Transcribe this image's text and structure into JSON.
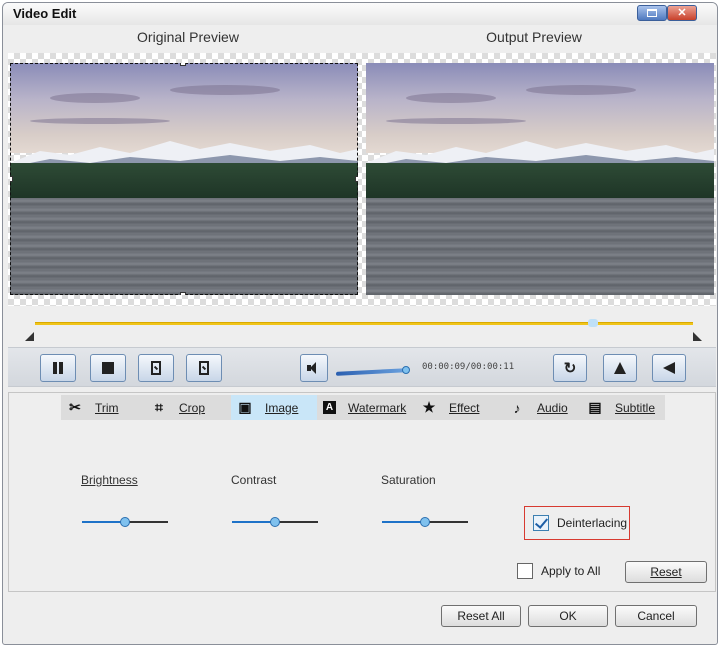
{
  "window": {
    "title": "Video Edit",
    "max_glyph": "max-icon",
    "close_glyph": "✕"
  },
  "preview": {
    "original_label": "Original Preview",
    "output_label": "Output Preview"
  },
  "playback": {
    "time": "00:00:09/00:00:11"
  },
  "tabs": [
    {
      "label": "Trim",
      "icon": "scissors-icon",
      "glyph": "✂"
    },
    {
      "label": "Crop",
      "icon": "crop-icon",
      "glyph": "⌗"
    },
    {
      "label": "Image",
      "icon": "image-icon",
      "glyph": "▣"
    },
    {
      "label": "Watermark",
      "icon": "watermark-icon",
      "glyph": "A"
    },
    {
      "label": "Effect",
      "icon": "star-icon",
      "glyph": "★"
    },
    {
      "label": "Audio",
      "icon": "music-note-icon",
      "glyph": "♪"
    },
    {
      "label": "Subtitle",
      "icon": "subtitle-icon",
      "glyph": "▤"
    }
  ],
  "active_tab": "Image",
  "image_settings": {
    "brightness": {
      "label": "Brightness",
      "level": 0.5
    },
    "contrast": {
      "label": "Contrast",
      "level": 0.5
    },
    "saturation": {
      "label": "Saturation",
      "level": 0.5
    },
    "deinterlacing": {
      "label": "Deinterlacing",
      "checked": true
    },
    "apply_to_all": {
      "label": "Apply to All",
      "checked": false
    },
    "reset_label": "Reset"
  },
  "footer": {
    "reset_all": "Reset All",
    "ok": "OK",
    "cancel": "Cancel"
  },
  "colors": {
    "timeline": "#f0c419",
    "accent": "#1e72c8",
    "highlight_border": "#d73a30",
    "active_tab": "#c9e6f8"
  }
}
